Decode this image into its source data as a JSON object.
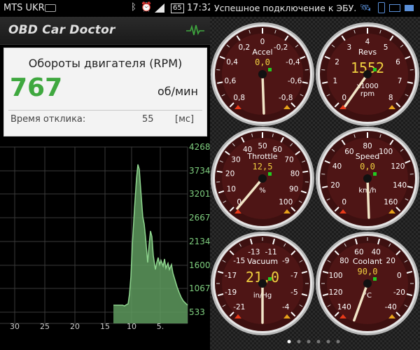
{
  "status_left": {
    "carrier": "MTS UKR",
    "battery": "65",
    "time": "17:32"
  },
  "status_right": {
    "notification": "Успешное подключение к ЭБУ."
  },
  "app": {
    "title": "OBD Car Doctor"
  },
  "rpm_card": {
    "name": "Обороты двигателя (RPM)",
    "value": "767",
    "unit": "об/мин",
    "response_label": "Время отклика:",
    "response_value": "55",
    "response_unit": "[мс]"
  },
  "history_chart": {
    "y_ticks": [
      "4268",
      "3734",
      "3201",
      "2667",
      "2134",
      "1600",
      "1067",
      "533"
    ],
    "x_ticks": [
      "30",
      "25",
      "20",
      "15",
      "10",
      "5."
    ],
    "colors": {
      "line": "#8fd68f",
      "fill": "#5e9a5e",
      "grid": "#3a3a3a",
      "ylabels": "#7fcf7f",
      "xlabels": "#cccccc"
    }
  },
  "gauges": [
    {
      "id": "accel",
      "label": "Accel",
      "value": "0,0",
      "value_color": "#f0d040",
      "unit": "",
      "ticks": [
        "0,8",
        "0,6",
        "0,4",
        "0,2",
        "0",
        "-0,2",
        "-0,4",
        "-0,6",
        "-0,8"
      ],
      "scale": [
        {
          "t": "0,8"
        },
        {
          "t": "0,6"
        },
        {
          "t": "0,4"
        },
        {
          "t": "0,2"
        },
        {
          "t": "0"
        },
        {
          "t": "-0,2"
        },
        {
          "t": "-0,4"
        },
        {
          "t": "-0,6"
        },
        {
          "t": "-0,8"
        }
      ]
    },
    {
      "id": "revs",
      "label": "Revs",
      "value": "1552",
      "value_color": "#f0d040",
      "unit": "x1000\nrpm",
      "ticks": [
        "0",
        "1",
        "2",
        "3",
        "4",
        "5",
        "6",
        "7",
        "8"
      ]
    },
    {
      "id": "throttle",
      "label": "Throttle",
      "value": "12,5",
      "value_color": "#f0d040",
      "unit": "%",
      "ticks": [
        "0",
        "10",
        "20",
        "30",
        "40",
        "50",
        "60",
        "70",
        "80",
        "90",
        "100"
      ]
    },
    {
      "id": "speed",
      "label": "Speed",
      "value": "0,0",
      "value_color": "#f0d040",
      "unit": "km/h",
      "ticks": [
        "0",
        "20",
        "40",
        "60",
        "80",
        "100",
        "120",
        "140",
        "160"
      ]
    },
    {
      "id": "vacuum",
      "label": "Vacuum",
      "value": "21,0",
      "value_color": "#f0d040",
      "unit": "in/Hg",
      "ticks": [
        "-21",
        "-19",
        "-17",
        "-15",
        "-13",
        "-11",
        "-9",
        "-7",
        "-5",
        "-4"
      ]
    },
    {
      "id": "coolant",
      "label": "Coolant",
      "value": "90,0",
      "value_color": "#f0d040",
      "unit": "°C",
      "ticks": [
        "140",
        "120",
        "100",
        "80",
        "60",
        "40",
        "20",
        "0",
        "-20",
        "-40"
      ]
    }
  ],
  "page_indicator": {
    "count": 6,
    "active": 0
  }
}
